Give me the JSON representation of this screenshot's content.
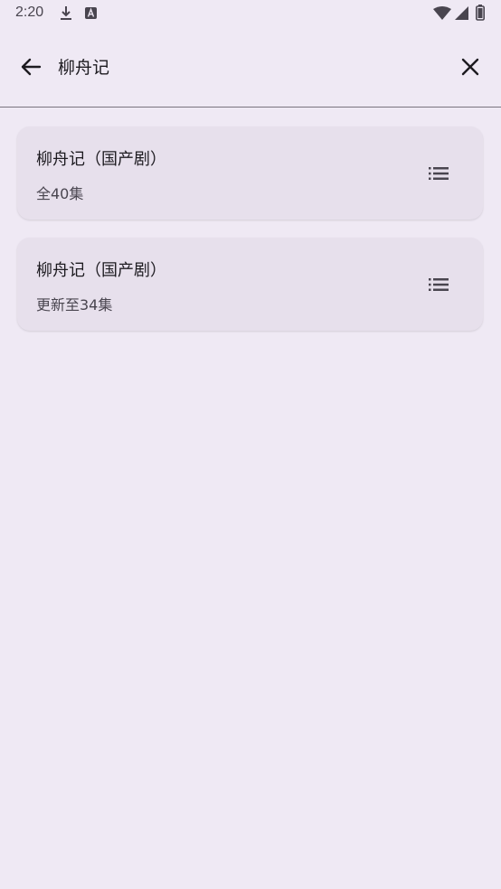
{
  "status_bar": {
    "time": "2:20",
    "icons": [
      "download-icon",
      "font-app-icon",
      "wifi-icon",
      "signal-icon",
      "battery-icon"
    ]
  },
  "search": {
    "query": "柳舟记",
    "back_icon": "arrow-left-icon",
    "clear_icon": "close-icon"
  },
  "results": [
    {
      "title": "柳舟记（国产剧）",
      "subtitle": "全40集",
      "icon": "list-icon"
    },
    {
      "title": "柳舟记（国产剧）",
      "subtitle": "更新至34集",
      "icon": "list-icon"
    }
  ],
  "colors": {
    "background": "#efe9f4",
    "card": "#e7e0ec",
    "text": "#1d1b20",
    "secondary_text": "#49454f"
  }
}
